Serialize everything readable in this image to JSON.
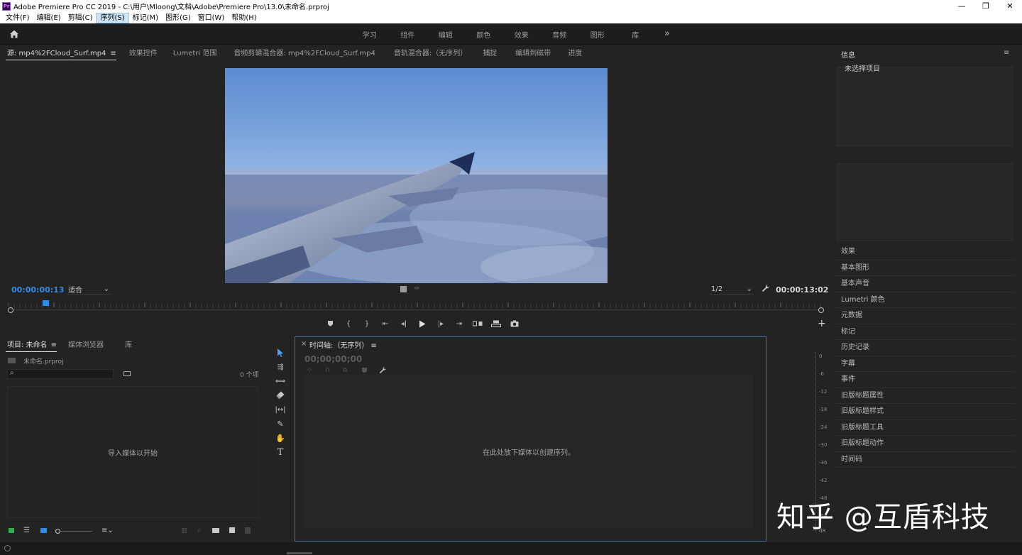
{
  "window": {
    "title": "Adobe Premiere Pro CC 2019 - C:\\用户\\Mloong\\文档\\Adobe\\Premiere Pro\\13.0\\未命名.prproj",
    "logo_text": "Pr",
    "minimize": "—",
    "restore": "❐",
    "close": "✕"
  },
  "menu": [
    "文件(F)",
    "编辑(E)",
    "剪辑(C)",
    "序列(S)",
    "标记(M)",
    "图形(G)",
    "窗口(W)",
    "帮助(H)"
  ],
  "workspaces": [
    "学习",
    "组件",
    "编辑",
    "颜色",
    "效果",
    "音频",
    "图形",
    "库"
  ],
  "workspace_more": "»",
  "source": {
    "tabs": [
      "源: mp4%2FCloud_Surf.mp4",
      "效果控件",
      "Lumetri 范围",
      "音频剪辑混合器: mp4%2FCloud_Surf.mp4",
      "音轨混合器:（无序列）",
      "捕捉",
      "编辑到磁带",
      "进度"
    ],
    "timecode_in": "00:00:00:13",
    "fit_label": "适合",
    "resolution": "1/2",
    "timecode_out": "00:00:13:02",
    "playhead_fraction": 0.04
  },
  "info": {
    "title": "信息",
    "empty_text": "未选择项目"
  },
  "right_panels": [
    "效果",
    "基本图形",
    "基本声音",
    "Lumetri 颜色",
    "元数据",
    "标记",
    "历史记录",
    "字幕",
    "事件",
    "旧版标题属性",
    "旧版标题样式",
    "旧版标题工具",
    "旧版标题动作",
    "时间码"
  ],
  "project": {
    "tabs": [
      "项目: 未命名",
      "媒体浏览器",
      "库"
    ],
    "file_name": "未命名.prproj",
    "item_count": "0 个项",
    "empty_text": "导入媒体以开始"
  },
  "timeline": {
    "tab": "时间轴:（无序列）",
    "close": "×",
    "timecode": "00;00;00;00",
    "empty_text": "在此处放下媒体以创建序列。"
  },
  "meter": {
    "labels": [
      "0",
      "-6",
      "-12",
      "-18",
      "-24",
      "-30",
      "-36",
      "-42",
      "-48",
      "-54",
      "dB"
    ]
  },
  "watermark": "知乎 @互盾科技",
  "colors": {
    "accent_blue": "#2d8ceb",
    "panel_bg": "#232323",
    "timeline_border": "#3f6ea8"
  }
}
